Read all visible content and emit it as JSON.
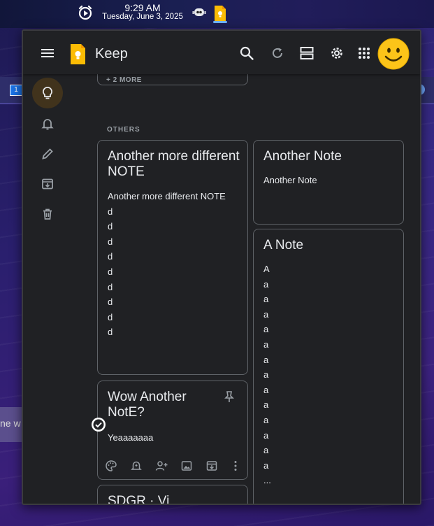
{
  "taskbar": {
    "time": "9:29 AM",
    "date": "Tuesday, June 3, 2025"
  },
  "background": {
    "calendar_chip": "1",
    "note_fragment": "ne w"
  },
  "app": {
    "title": "Keep",
    "more_label": "+ 2 MORE",
    "section_label": "OTHERS",
    "notes": [
      {
        "title": "Another more different NOTE",
        "lines": [
          "Another more different NOTE",
          "d",
          "d",
          "d",
          "d",
          "d",
          "d",
          "d",
          "d",
          "d"
        ]
      },
      {
        "title": "Another Note",
        "lines": [
          "Another Note"
        ]
      },
      {
        "title": "A Note",
        "lines": [
          "A",
          "a",
          "a",
          "a",
          "a",
          "a",
          "a",
          "a",
          "a",
          "a",
          "a",
          "a",
          "a",
          "a",
          "..."
        ]
      },
      {
        "title": "Wow Another NotE?",
        "lines": [
          "Yeaaaaaaa"
        ]
      },
      {
        "title": "SDGR · Vi"
      }
    ]
  },
  "colors": {
    "accent": "#fbbc04",
    "sidebar_active": "#41331c",
    "surface": "#202124",
    "border": "#5f6368"
  }
}
